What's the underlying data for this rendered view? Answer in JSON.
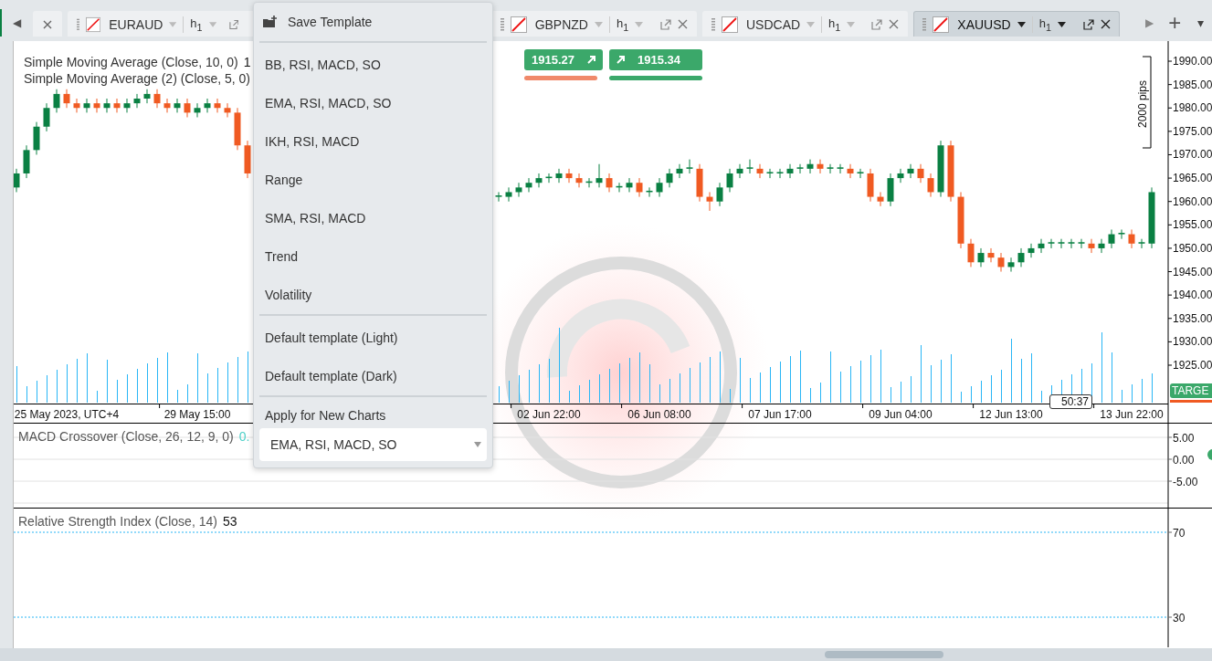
{
  "tab_bar": {
    "scroll_left": "◀",
    "scroll_right": "▶",
    "add": "+",
    "more": "▾",
    "tabs": [
      {
        "kind": "partial",
        "selected": false
      },
      {
        "kind": "clipped",
        "symbol": "EURAUD",
        "timeframe": "h$_{1}$",
        "selected": false
      },
      {
        "kind": "full",
        "symbol": "GBPNZD",
        "timeframe": "h$_{1}$",
        "selected": false
      },
      {
        "kind": "full",
        "symbol": "USDCAD",
        "timeframe": "h$_{1}$",
        "selected": false
      },
      {
        "kind": "full",
        "symbol": "XAUUSD",
        "timeframe": "h$_{1}$",
        "selected": true
      }
    ]
  },
  "chart": {
    "indicators": [
      {
        "label": "Simple Moving Average (Close, 10, 0)",
        "value": "1"
      },
      {
        "label": "Simple Moving Average (2) (Close, 5, 0)"
      }
    ],
    "price_badges": [
      {
        "kind": "sell",
        "price": "1915.27"
      },
      {
        "kind": "buy",
        "price": "1915.34"
      }
    ],
    "pips_label": "2000 pips",
    "chart_data": {
      "type": "candlestick",
      "categories": [
        null,
        null,
        null,
        null,
        null,
        "25 May 2023, UTC+4",
        null,
        null,
        null,
        null,
        null,
        null,
        null,
        null,
        null,
        null,
        null,
        null,
        "29 May 15:00",
        null,
        null,
        null,
        null,
        null,
        null,
        null,
        null,
        null,
        null,
        null,
        null,
        null,
        null,
        null,
        null,
        null,
        null,
        null,
        null,
        null,
        null,
        null,
        null,
        null,
        null,
        null,
        null,
        null,
        null,
        null,
        null,
        null,
        null,
        "02 Jun 22:00",
        null,
        null,
        null,
        null,
        null,
        null,
        null,
        null,
        null,
        null,
        "06 Jun 08:00",
        null,
        null,
        null,
        null,
        null,
        null,
        null,
        null,
        null,
        null,
        null,
        "07 Jun 17:00",
        null,
        null,
        null,
        null,
        null,
        null,
        null,
        null,
        null,
        null,
        null,
        "09 Jun 04:00",
        null,
        null,
        null,
        null,
        null,
        null,
        null,
        null,
        null,
        null,
        "12 Jun 13:00",
        null,
        null,
        null,
        null,
        null,
        null,
        null,
        null,
        null,
        null,
        null,
        "13 Jun 22:00",
        null,
        null
      ],
      "ylim": [
        1916.8,
        1994.3
      ],
      "yticks": [
        {
          "value": 1990,
          "label": "1990.00"
        },
        {
          "value": 1985,
          "label": "1985.00"
        },
        {
          "value": 1980,
          "label": "1980.00"
        },
        {
          "value": 1975,
          "label": "1975.00"
        },
        {
          "value": 1970,
          "label": "1970.00"
        },
        {
          "value": 1965,
          "label": "1965.00"
        },
        {
          "value": 1960,
          "label": "1960.00"
        },
        {
          "value": 1955,
          "label": "1955.00"
        },
        {
          "value": 1950,
          "label": "1950.00"
        },
        {
          "value": 1945,
          "label": "1945.00"
        },
        {
          "value": 1940,
          "label": "1940.00"
        },
        {
          "value": 1935,
          "label": "1935.00"
        },
        {
          "value": 1930,
          "label": "1930.00"
        },
        {
          "value": 1925,
          "label": "1925.00"
        }
      ],
      "ohlc": [
        [
          1963,
          1967,
          1962,
          1966
        ],
        [
          1966,
          1972,
          1965,
          1971
        ],
        [
          1971,
          1977,
          1970,
          1976
        ],
        [
          1976,
          1981,
          1975,
          1980
        ],
        [
          1980,
          1984,
          1979,
          1983
        ],
        [
          1983,
          1984,
          1980,
          1981
        ],
        [
          1981,
          1982,
          1979,
          1980
        ],
        [
          1980,
          1982,
          1979,
          1981
        ],
        [
          1981,
          1982,
          1979,
          1980
        ],
        [
          1980,
          1982,
          1979,
          1981
        ],
        [
          1981,
          1982,
          1979,
          1980
        ],
        [
          1980,
          1982,
          1979,
          1981
        ],
        [
          1981,
          1983,
          1980,
          1982
        ],
        [
          1982,
          1984,
          1981,
          1983
        ],
        [
          1983,
          1984,
          1980,
          1981
        ],
        [
          1981,
          1982,
          1979,
          1980
        ],
        [
          1980,
          1982,
          1979,
          1981
        ],
        [
          1981,
          1982,
          1978,
          1979
        ],
        [
          1979,
          1981,
          1978,
          1980
        ],
        [
          1980,
          1982,
          1979,
          1981
        ],
        [
          1981,
          1982,
          1979,
          1980
        ],
        [
          1980,
          1981,
          1978,
          1979
        ],
        [
          1979,
          1980,
          1971,
          1972
        ],
        [
          1972,
          1973,
          1965,
          1966
        ],
        null,
        null,
        null,
        null,
        null,
        null,
        null,
        null,
        null,
        null,
        null,
        null,
        null,
        null,
        null,
        null,
        null,
        null,
        null,
        null,
        null,
        null,
        null,
        null,
        [
          1961,
          1962,
          1960,
          1961.3
        ],
        [
          1961,
          1963,
          1960,
          1962
        ],
        [
          1962,
          1964,
          1961,
          1963
        ],
        [
          1963,
          1965,
          1962,
          1964
        ],
        [
          1964,
          1966,
          1963,
          1965
        ],
        [
          1965,
          1966,
          1964,
          1965.3
        ],
        [
          1965,
          1967,
          1964,
          1966
        ],
        [
          1966,
          1967,
          1964,
          1965
        ],
        [
          1965,
          1966,
          1963,
          1964
        ],
        [
          1964,
          1965,
          1963,
          1964.3
        ],
        [
          1964,
          1968,
          1963,
          1965
        ],
        [
          1965,
          1966,
          1962,
          1963
        ],
        [
          1963,
          1964,
          1962,
          1963.3
        ],
        [
          1963,
          1965,
          1962,
          1964
        ],
        [
          1964,
          1965,
          1961,
          1962
        ],
        [
          1962,
          1963,
          1961,
          1962.3
        ],
        [
          1962,
          1965,
          1961,
          1964
        ],
        [
          1964,
          1967,
          1963,
          1966
        ],
        [
          1966,
          1968,
          1965,
          1967
        ],
        [
          1967,
          1969,
          1966,
          1967.3
        ],
        [
          1967,
          1968,
          1960,
          1961
        ],
        [
          1961,
          1962,
          1958,
          1960
        ],
        [
          1960,
          1964,
          1959,
          1963
        ],
        [
          1963,
          1967,
          1962,
          1966
        ],
        [
          1966,
          1968,
          1965,
          1967
        ],
        [
          1967,
          1969,
          1966,
          1967.3
        ],
        [
          1967,
          1968,
          1965,
          1966
        ],
        [
          1966,
          1967,
          1965,
          1966.3
        ],
        [
          1966,
          1967,
          1965,
          1966.3
        ],
        [
          1966,
          1968,
          1965,
          1967
        ],
        [
          1967,
          1968,
          1966,
          1967.3
        ],
        [
          1967,
          1969,
          1966,
          1968
        ],
        [
          1968,
          1969,
          1966,
          1967
        ],
        [
          1967,
          1968,
          1966,
          1967.3
        ],
        [
          1967,
          1968,
          1966,
          1967.3
        ],
        [
          1967,
          1968,
          1965,
          1966
        ],
        [
          1966,
          1967,
          1965,
          1966.3
        ],
        [
          1966,
          1967,
          1960,
          1961
        ],
        [
          1961,
          1962,
          1959,
          1960
        ],
        [
          1960,
          1966,
          1959,
          1965
        ],
        [
          1965,
          1967,
          1964,
          1966
        ],
        [
          1966,
          1968,
          1965,
          1967
        ],
        [
          1967,
          1968,
          1964,
          1965
        ],
        [
          1965,
          1966,
          1961,
          1962
        ],
        [
          1962,
          1973,
          1961,
          1972
        ],
        [
          1972,
          1973,
          1960,
          1961
        ],
        [
          1961,
          1962,
          1950,
          1951
        ],
        [
          1951,
          1952,
          1946,
          1947
        ],
        [
          1947,
          1950,
          1946,
          1949
        ],
        [
          1949,
          1950,
          1947,
          1948
        ],
        [
          1948,
          1949,
          1945,
          1946
        ],
        [
          1946,
          1948,
          1945,
          1947
        ],
        [
          1947,
          1950,
          1946,
          1949
        ],
        [
          1949,
          1951,
          1948,
          1950
        ],
        [
          1950,
          1952,
          1949,
          1951
        ],
        [
          1951,
          1952,
          1950,
          1951.3
        ],
        [
          1951,
          1952,
          1950,
          1951.3
        ],
        [
          1951,
          1952,
          1950,
          1951.3
        ],
        [
          1951,
          1952,
          1950,
          1951.3
        ],
        [
          1951,
          1952,
          1949,
          1950
        ],
        [
          1950,
          1952,
          1949,
          1951
        ],
        [
          1951,
          1954,
          1950,
          1953
        ],
        [
          1953,
          1954,
          1952,
          1953.3
        ],
        [
          1953,
          1954,
          1950,
          1951
        ],
        [
          1951,
          1952,
          1950,
          1951.3
        ],
        [
          1951,
          1963,
          1950,
          1962
        ]
      ]
    },
    "countdown": "50:37",
    "target": "TARGE"
  },
  "macd": {
    "label": "MACD Crossover (Close, 26, 12, 9, 0)",
    "value": "0.",
    "axis": [
      "5.00",
      "0.00",
      "-5.00"
    ]
  },
  "rsi": {
    "label": "Relative Strength Index (Close, 14)",
    "value": "53",
    "axis": [
      "70",
      "30"
    ]
  },
  "menu": {
    "save": "Save Template",
    "sections": [
      [
        "BB, RSI, MACD, SO",
        "EMA, RSI, MACD, SO",
        "IKH, RSI, MACD",
        "Range",
        "SMA, RSI, MACD",
        "Trend",
        "Volatility"
      ],
      [
        "Default template (Light)",
        "Default template (Dark)"
      ]
    ],
    "apply_label": "Apply for New Charts",
    "apply_value": "EMA, RSI, MACD, SO"
  }
}
